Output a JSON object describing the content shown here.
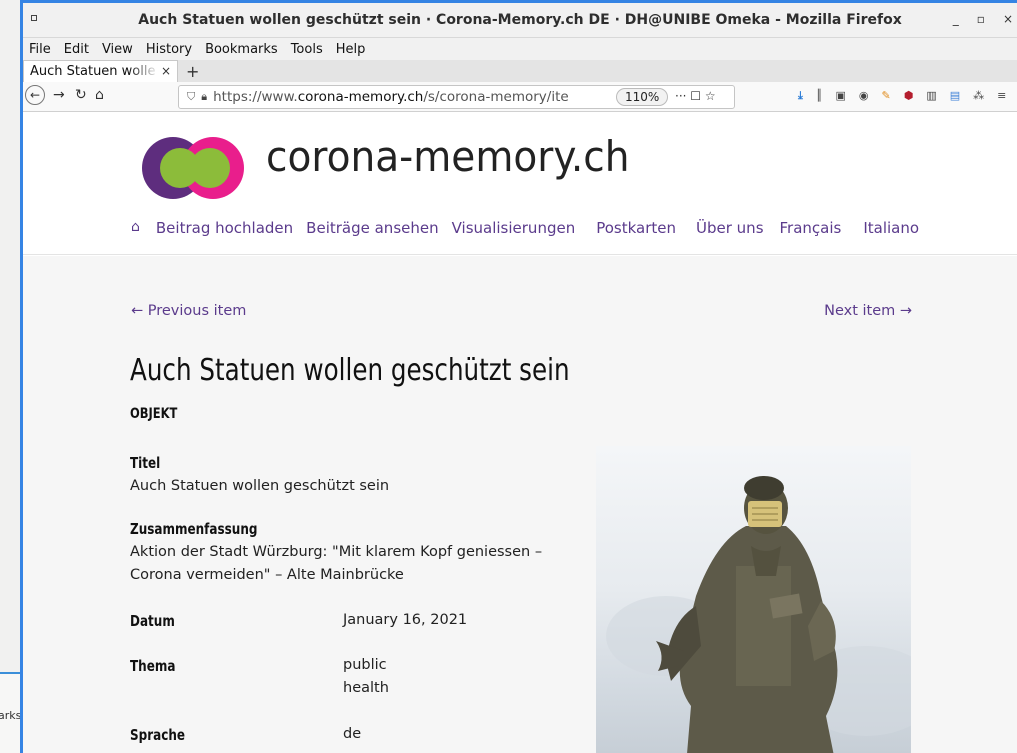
{
  "browser": {
    "window_title": "Auch Statuen wollen geschützt sein · Corona-Memory.ch DE · DH@UNIBE Omeka - Mozilla Firefox",
    "window_controls": {
      "minimize": "_",
      "maximize": "▫",
      "close": "×"
    },
    "menu": [
      "File",
      "Edit",
      "View",
      "History",
      "Bookmarks",
      "Tools",
      "Help"
    ],
    "tab": {
      "label": "Auch Statuen wolle",
      "close": "×"
    },
    "new_tab": "+",
    "url_prefix": "https://www.",
    "url_domain": "corona-memory.ch",
    "url_path": "/s/corona-memory/ite",
    "zoom": "110%",
    "url_actions": "··· ☐ ☆"
  },
  "background_window": {
    "partial_label": "arks"
  },
  "site": {
    "name": "corona-memory.ch",
    "nav": {
      "home": "⌂",
      "items": [
        "Beitrag hochladen",
        "Beiträge ansehen",
        "Visualisierungen",
        "Postkarten",
        "Über uns",
        "Français",
        "Italiano"
      ]
    }
  },
  "item": {
    "prev": "← Previous item",
    "next": "Next item →",
    "title": "Auch Statuen wollen geschützt sein",
    "type": "OBJEKT",
    "fields": {
      "titel_label": "Titel",
      "titel_value": "Auch Statuen wollen geschützt sein",
      "zusammenfassung_label": "Zusammenfassung",
      "zusammenfassung_line1": "Aktion der Stadt Würzburg: \"Mit klarem Kopf geniessen –",
      "zusammenfassung_line2": "Corona vermeiden\" – Alte Mainbrücke",
      "datum_label": "Datum",
      "datum_value": "January 16, 2021",
      "thema_label": "Thema",
      "thema_value1": "public",
      "thema_value2": "health",
      "sprache_label": "Sprache",
      "sprache_value": "de"
    }
  },
  "colors": {
    "accent": "#5b3b8c",
    "window_border": "#3584e4"
  }
}
